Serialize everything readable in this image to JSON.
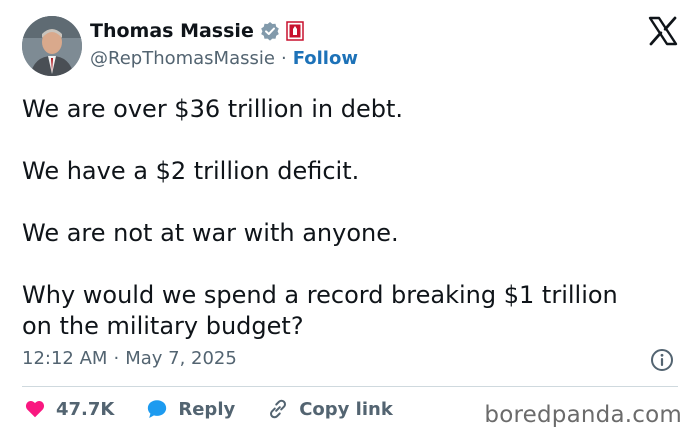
{
  "author": {
    "name": "Thomas Massie",
    "handle": "@RepThomasMassie",
    "separator": "·",
    "follow_label": "Follow"
  },
  "icons": {
    "verified": "verified-badge-icon",
    "affiliation": "congress-badge-icon",
    "platform": "x-logo-icon",
    "info": "info-icon"
  },
  "tweet": {
    "paragraphs": [
      "We are over $36 trillion in debt.",
      "We have a $2 trillion deficit.",
      "We are not at war with anyone.",
      "Why would we spend a record breaking $1 trillion\non the military budget?"
    ],
    "time": "12:12 AM",
    "separator": "·",
    "date": "May 7, 2025"
  },
  "actions": {
    "likes": "47.7K",
    "reply_label": "Reply",
    "copy_link_label": "Copy link"
  },
  "watermark": "boredpanda.com",
  "colors": {
    "follow": "#1d72b8",
    "like_heart": "#f91880",
    "reply_bubble": "#1d9bf0",
    "verified": "#829aab",
    "badge": "#c8102e"
  }
}
